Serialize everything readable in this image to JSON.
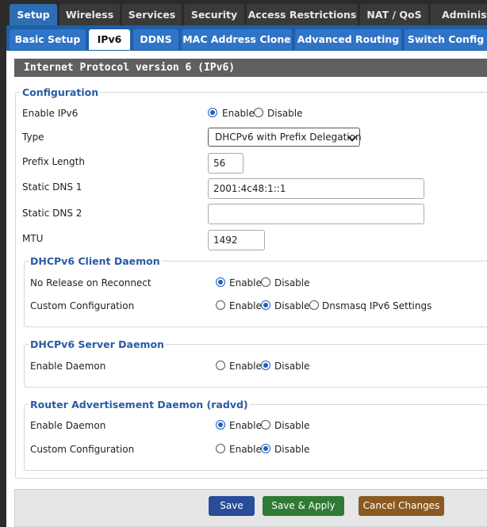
{
  "top_tabs": [
    "Setup",
    "Wireless",
    "Services",
    "Security",
    "Access Restrictions",
    "NAT / QoS",
    "Administr"
  ],
  "sub_tabs": [
    "Basic Setup",
    "IPv6",
    "DDNS",
    "MAC Address Clone",
    "Advanced Routing",
    "Switch Config"
  ],
  "section_title": "Internet Protocol version 6 (IPv6)",
  "configuration": {
    "legend": "Configuration",
    "enable_ipv6": {
      "label": "Enable IPv6",
      "enable": "Enable",
      "disable": "Disable"
    },
    "type": {
      "label": "Type",
      "value": "DHCPv6 with Prefix Delegation"
    },
    "prefix_length": {
      "label": "Prefix Length",
      "value": "56"
    },
    "static_dns1": {
      "label": "Static DNS 1",
      "value": "2001:4c48:1::1"
    },
    "static_dns2": {
      "label": "Static DNS 2",
      "value": ""
    },
    "mtu": {
      "label": "MTU",
      "value": "1492"
    }
  },
  "dhcp_client": {
    "legend": "DHCPv6 Client Daemon",
    "no_release": {
      "label": "No Release on Reconnect",
      "enable": "Enable",
      "disable": "Disable"
    },
    "custom_config": {
      "label": "Custom Configuration",
      "enable": "Enable",
      "disable": "Disable",
      "dnsmasq": "Dnsmasq IPv6 Settings"
    }
  },
  "dhcp_server": {
    "legend": "DHCPv6 Server Daemon",
    "enable_daemon": {
      "label": "Enable Daemon",
      "enable": "Enable",
      "disable": "Disable"
    }
  },
  "radvd": {
    "legend": "Router Advertisement Daemon (radvd)",
    "enable_daemon": {
      "label": "Enable Daemon",
      "enable": "Enable",
      "disable": "Disable"
    },
    "custom_config": {
      "label": "Custom Configuration",
      "enable": "Enable",
      "disable": "Disable"
    }
  },
  "buttons": {
    "save": "Save",
    "save_apply": "Save & Apply",
    "cancel": "Cancel Changes"
  },
  "colors": {
    "active_tab": "#2f6db1",
    "save": "#2a4d9a",
    "save_apply": "#2f7a34",
    "cancel": "#8a5a22"
  }
}
